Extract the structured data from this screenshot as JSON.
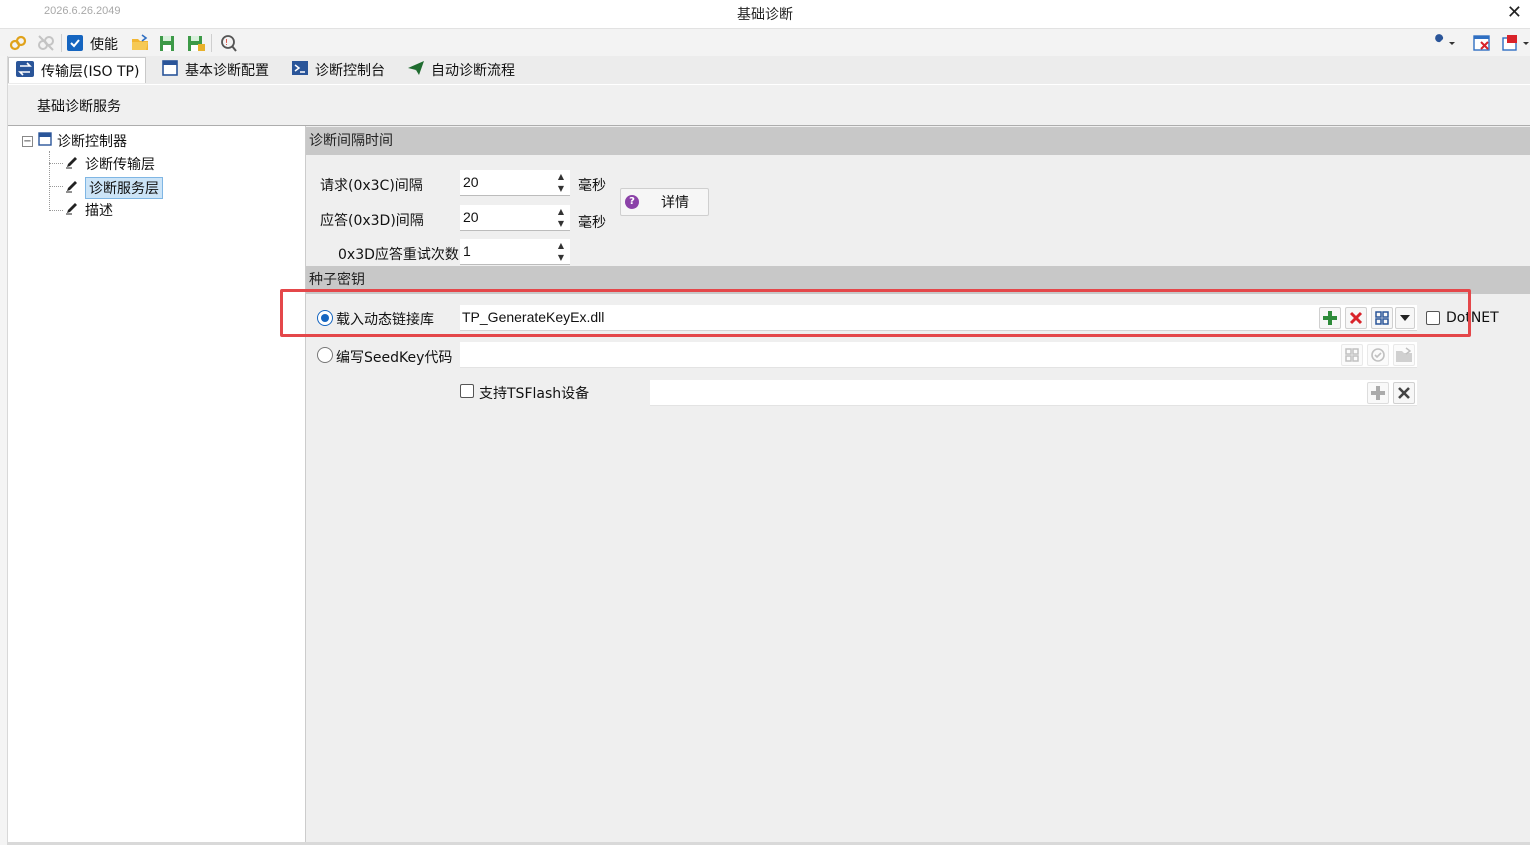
{
  "window": {
    "version": "2026.6.26.2049",
    "title": "基础诊断",
    "close_glyph": "✕"
  },
  "toolbar": {
    "enable_label": "使能",
    "enable_checked": true
  },
  "tabs": [
    {
      "label": "传输层(ISO TP)",
      "icon": "swap-arrows-icon",
      "active": true
    },
    {
      "label": "基本诊断配置",
      "icon": "window-icon",
      "active": false
    },
    {
      "label": "诊断控制台",
      "icon": "console-icon",
      "active": false
    },
    {
      "label": "自动诊断流程",
      "icon": "send-icon",
      "active": false
    }
  ],
  "ribbon": {
    "label": "基础诊断服务"
  },
  "tree": {
    "root": "诊断控制器",
    "expander": "−",
    "children": [
      {
        "label": "诊断传输层",
        "selected": false
      },
      {
        "label": "诊断服务层",
        "selected": true
      },
      {
        "label": "描述",
        "selected": false
      }
    ]
  },
  "interval_section": {
    "header": "诊断间隔时间",
    "request_label": "请求(0x3C)间隔",
    "request_value": "20",
    "request_unit": "毫秒",
    "response_label": "应答(0x3D)间隔",
    "response_value": "20",
    "response_unit": "毫秒",
    "retry_label": "0x3D应答重试次数",
    "retry_value": "1",
    "detail_button": "详情",
    "detail_icon_glyph": "?"
  },
  "seed_section": {
    "header": "种子密钥",
    "load_dll_label": "载入动态链接库",
    "load_dll_selected": true,
    "dll_value": "TP_GenerateKeyEx.dll",
    "dotnet_label": "DotNET",
    "dotnet_checked": false,
    "write_code_label": "编写SeedKey代码",
    "write_code_selected": false,
    "tsflash_label": "支持TSFlash设备",
    "tsflash_checked": false
  },
  "colors": {
    "accent_blue": "#1565c0",
    "add_green": "#2e8b3a",
    "delete_red": "#d9232a",
    "highlight_red": "#e4474a",
    "section_header": "#c8c8c8"
  }
}
